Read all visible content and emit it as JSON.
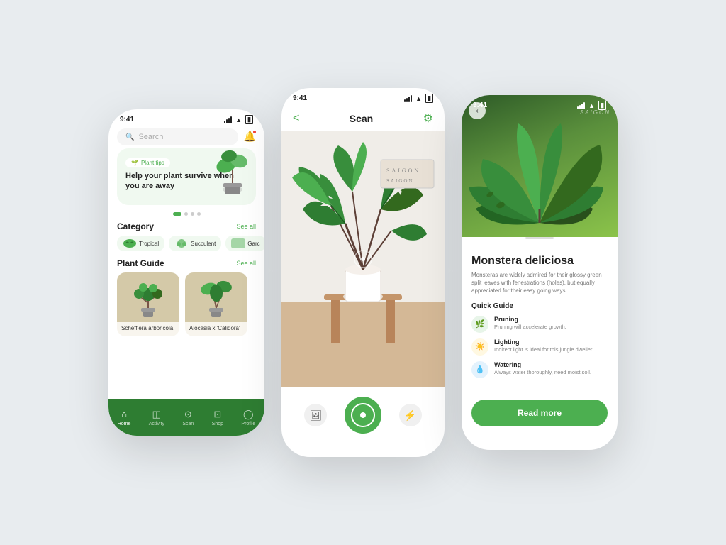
{
  "left_phone": {
    "status": {
      "time": "9:41",
      "signal": "▎▎▎",
      "wifi": "wifi",
      "battery": "battery"
    },
    "search": {
      "placeholder": "Search"
    },
    "hero": {
      "badge": "Plant tips",
      "headline": "Help your plant survive when you are away"
    },
    "dots": [
      {
        "active": true
      },
      {
        "active": false
      },
      {
        "active": false
      },
      {
        "active": false
      }
    ],
    "category": {
      "title": "Category",
      "see_all": "See all",
      "items": [
        {
          "name": "Tropical"
        },
        {
          "name": "Succulent"
        },
        {
          "name": "Garc"
        }
      ]
    },
    "plant_guide": {
      "title": "Plant Guide",
      "see_all": "See all",
      "plants": [
        {
          "name": "Schefflera arboricola"
        },
        {
          "name": "Alocasia x 'Calidora'"
        }
      ]
    },
    "nav": {
      "items": [
        {
          "label": "Home",
          "icon": "⌂",
          "active": true
        },
        {
          "label": "Activity",
          "icon": "◫",
          "active": false
        },
        {
          "label": "Scan",
          "icon": "⊙",
          "active": false
        },
        {
          "label": "Shop",
          "icon": "⊡",
          "active": false
        },
        {
          "label": "Profile",
          "icon": "◯",
          "active": false
        }
      ]
    }
  },
  "center_phone": {
    "status": {
      "time": "9:41"
    },
    "header": {
      "back": "<",
      "title": "Scan",
      "settings": "⚙"
    },
    "scan_actions": {
      "gallery": "🖼",
      "capture": "",
      "bolt": "⚡"
    }
  },
  "right_phone": {
    "status": {
      "time": "9:41"
    },
    "plant": {
      "name": "Monstera deliciosa",
      "description": "Monsteras are widely admired for their glossy green split leaves with fenestrations (holes), but equally appreciated for their easy going ways.",
      "quick_guide_title": "Quick Guide",
      "guides": [
        {
          "icon": "🌿",
          "icon_type": "pruning",
          "label": "Pruning",
          "desc": "Pruning will accelerate growth."
        },
        {
          "icon": "☀",
          "icon_type": "lighting",
          "label": "Lighting",
          "desc": "Indirect light is ideal for this jungle dweller."
        },
        {
          "icon": "💧",
          "icon_type": "watering",
          "label": "Watering",
          "desc": "Always water thoroughly, need moist soil."
        }
      ]
    },
    "read_more_btn": "Read more"
  }
}
